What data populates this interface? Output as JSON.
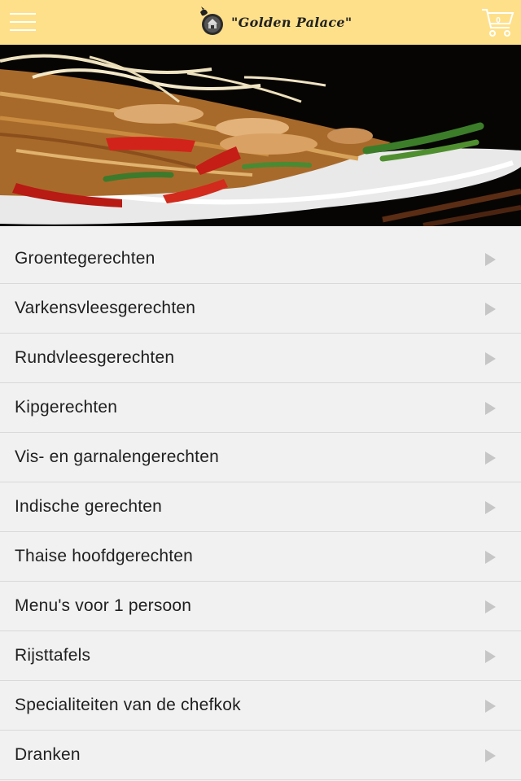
{
  "header": {
    "brand_name": "\"Golden Palace\"",
    "menu_icon": "hamburger-menu-icon",
    "cart_icon": "shopping-cart-icon",
    "cart_count": "0",
    "colors": {
      "header_bg": "#ffe08a",
      "icon": "#ffffff"
    }
  },
  "hero": {
    "image": "stir-fried-noodles-with-chicken-and-vegetables"
  },
  "menu": {
    "categories": [
      {
        "label": "Groentegerechten"
      },
      {
        "label": "Varkensvleesgerechten"
      },
      {
        "label": "Rundvleesgerechten"
      },
      {
        "label": "Kipgerechten"
      },
      {
        "label": "Vis- en garnalengerechten"
      },
      {
        "label": "Indische gerechten"
      },
      {
        "label": "Thaise hoofdgerechten"
      },
      {
        "label": "Menu's voor 1 persoon"
      },
      {
        "label": "Rijsttafels"
      },
      {
        "label": "Specialiteiten van de chefkok"
      },
      {
        "label": "Dranken"
      }
    ],
    "arrow_icon": "chevron-right-icon"
  }
}
